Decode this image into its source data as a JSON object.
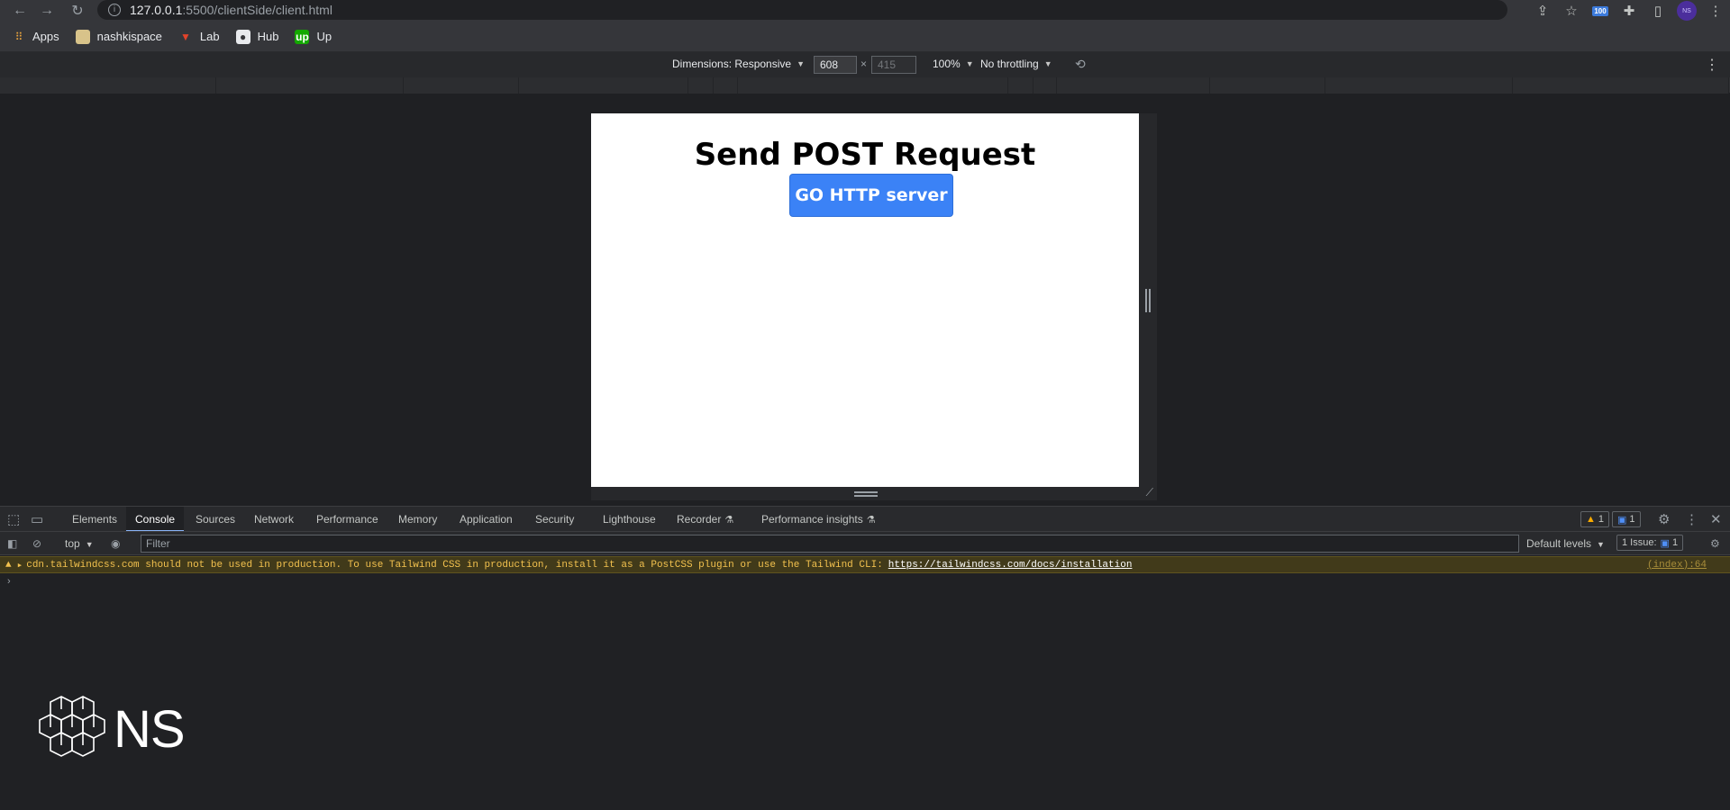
{
  "browser": {
    "url_host": "127.0.0.1",
    "url_path": ":5500/clientSide/client.html",
    "extension_badge": "100",
    "avatar_label": "NS",
    "bookmarks": [
      {
        "label": "Apps",
        "icon": "apps-grid-icon"
      },
      {
        "label": "nashkispace",
        "icon": "folder-icon"
      },
      {
        "label": "Lab",
        "icon": "gitlab-icon"
      },
      {
        "label": "Hub",
        "icon": "github-icon"
      },
      {
        "label": "Up",
        "icon": "upwork-icon"
      }
    ]
  },
  "device_toolbar": {
    "dimensions": "Dimensions: Responsive",
    "width": "608",
    "height": "415",
    "zoom": "100%",
    "throttling": "No throttling"
  },
  "page": {
    "heading": "Send POST Request",
    "button_label": "GO HTTP server",
    "button_color": "#3b82f6"
  },
  "devtools": {
    "tabs": [
      "Elements",
      "Console",
      "Sources",
      "Network",
      "Performance",
      "Memory",
      "Application",
      "Security",
      "Lighthouse",
      "Recorder",
      "Performance insights"
    ],
    "active_tab": "Console",
    "warning_count": "1",
    "message_count": "1",
    "context": "top",
    "filter_placeholder": "Filter",
    "levels": "Default levels",
    "issues": "1 Issue:",
    "issues_count": "1",
    "warning_message": "cdn.tailwindcss.com should not be used in production. To use Tailwind CSS in production, install it as a PostCSS plugin or use the Tailwind CLI:",
    "warning_link": "https://tailwindcss.com/docs/installation",
    "warning_source": "(index):64",
    "prompt": "›"
  },
  "logo": {
    "text": "NS"
  }
}
